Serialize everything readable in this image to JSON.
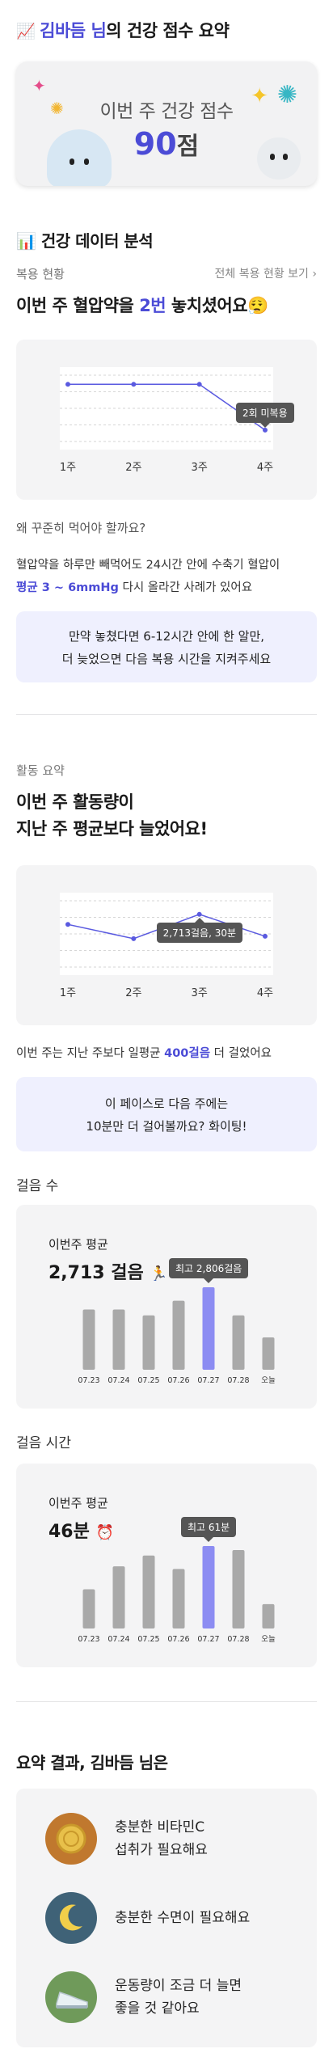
{
  "header": {
    "emoji": "📈",
    "name": "김바듬 님",
    "suffix": "의 건강 점수 요약"
  },
  "hero": {
    "title": "이번 주 건강 점수",
    "score": "90",
    "unit": "점"
  },
  "analysis": {
    "emoji": "📊",
    "title": "건강 데이터 분석"
  },
  "medication": {
    "section_label": "복용 현황",
    "link_label": "전체 복용 현황 보기",
    "headline_pre": "이번 주 혈압약을 ",
    "headline_hl": "2번",
    "headline_post": " 놓치셨어요",
    "headline_emoji": "😮‍💨",
    "chart_data": {
      "type": "line",
      "categories": [
        "1주",
        "2주",
        "3주",
        "4주"
      ],
      "values": [
        2,
        2,
        2,
        0
      ],
      "annotation": "2회 미복용"
    },
    "why_title": "왜 꾸준히 먹어야 할까요?",
    "why_body_1": "혈압약을 하루만 빼먹어도 24시간 안에 수축기 혈압이",
    "why_body_hl": "평균 3 ~ 6mmHg",
    "why_body_2": " 다시 올라간 사례가 있어요",
    "tip_line1": "만약 놓쳤다면 6-12시간 안에 한 알만,",
    "tip_line2": "더 늦었으면 다음 복용 시간을 지켜주세요"
  },
  "activity": {
    "section_label": "활동 요약",
    "headline_line1": "이번 주 활동량이",
    "headline_line2": "지난 주 평균보다 늘었어요!",
    "chart_data": {
      "type": "line",
      "categories": [
        "1주",
        "2주",
        "3주",
        "4주"
      ],
      "values": [
        2500,
        2200,
        2713,
        2250
      ],
      "annotation": "2,713걸음, 30분"
    },
    "body_pre": "이번 주는 지난 주보다 일평균 ",
    "body_hl": "400걸음",
    "body_post": " 더 걸었어요",
    "tip_line1": "이 페이스로 다음 주에는",
    "tip_line2": "10분만 더 걸어볼까요? 화이팅!"
  },
  "steps": {
    "section_label": "걸음 수",
    "avg_label": "이번주 평균",
    "avg_value": "2,713 걸음",
    "avg_emoji": "🏃",
    "chart_data": {
      "type": "bar",
      "categories": [
        "07.23",
        "07.24",
        "07.25",
        "07.26",
        "07.27",
        "07.28",
        "오늘"
      ],
      "values": [
        2050,
        2050,
        1850,
        2350,
        2806,
        1850,
        1100
      ],
      "highlight_index": 4,
      "annotation": "최고 2,806걸음"
    }
  },
  "walk_time": {
    "section_label": "걸음 시간",
    "avg_label": "이번주 평균",
    "avg_value": "46분",
    "avg_emoji": "⏰",
    "chart_data": {
      "type": "bar",
      "categories": [
        "07.23",
        "07.24",
        "07.25",
        "07.26",
        "07.27",
        "07.28",
        "오늘"
      ],
      "values": [
        29,
        46,
        54,
        44,
        61,
        58,
        18
      ],
      "highlight_index": 4,
      "annotation": "최고 61분"
    }
  },
  "summary": {
    "title": "요약 결과, 김바듬 님은",
    "items": [
      {
        "line1": "충분한 비타민C",
        "line2": "섭취가 필요해요",
        "icon": "coin-icon",
        "color": "#c0782e"
      },
      {
        "line1": "충분한 수면이 필요해요",
        "line2": "",
        "icon": "moon-icon",
        "color": "#3f6277"
      },
      {
        "line1": "운동량이 조금 더 늘면",
        "line2": "좋을 것 같아요",
        "icon": "sneaker-icon",
        "color": "#6f9a5a"
      }
    ]
  },
  "colors": {
    "accent": "#4b4bd6",
    "bar": "#a9a9a9",
    "bar_highlight": "#8c8cf2",
    "line": "#5a5ae0"
  }
}
